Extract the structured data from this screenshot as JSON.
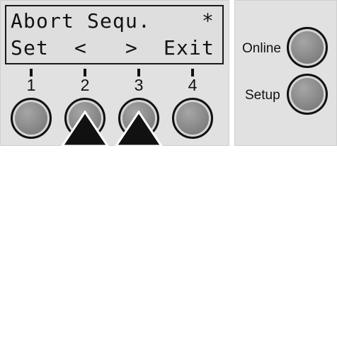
{
  "display": {
    "line1": [
      "A",
      "b",
      "o",
      "r",
      "t",
      " ",
      "S",
      "e",
      "q",
      "u",
      ".",
      " ",
      " ",
      " ",
      " ",
      "*"
    ],
    "line2": [
      "S",
      "e",
      "t",
      " ",
      " ",
      "<",
      " ",
      " ",
      " ",
      ">",
      " ",
      " ",
      "E",
      "x",
      "i",
      "t"
    ]
  },
  "keys": [
    {
      "number": "1"
    },
    {
      "number": "2"
    },
    {
      "number": "3"
    },
    {
      "number": "4"
    }
  ],
  "pressed_keys": [
    "2",
    "3"
  ],
  "side_buttons": {
    "online_label": "Online",
    "setup_label": "Setup"
  }
}
